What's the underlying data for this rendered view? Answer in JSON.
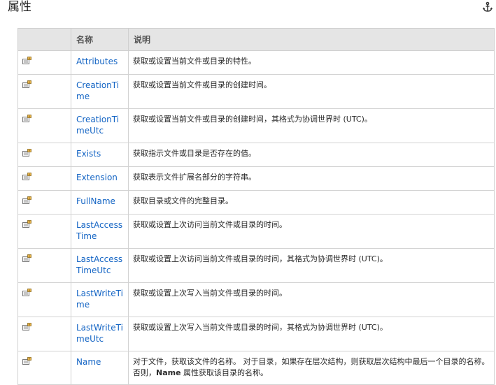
{
  "section": {
    "title": "属性",
    "anchor_icon": "anchor-icon"
  },
  "table": {
    "headers": [
      "",
      "名称",
      "说明"
    ],
    "rows": [
      {
        "icon": "property-icon",
        "name": "Attributes",
        "description": "获取或设置当前文件或目录的特性。"
      },
      {
        "icon": "property-icon",
        "name": "CreationTime",
        "description": "获取或设置当前文件或目录的创建时间。"
      },
      {
        "icon": "property-icon",
        "name": "CreationTimeUtc",
        "description": "获取或设置当前文件或目录的创建时间，其格式为协调世界时 (UTC)。"
      },
      {
        "icon": "property-icon",
        "name": "Exists",
        "description": "获取指示文件或目录是否存在的值。"
      },
      {
        "icon": "property-icon",
        "name": "Extension",
        "description": "获取表示文件扩展名部分的字符串。"
      },
      {
        "icon": "property-icon",
        "name": "FullName",
        "description": "获取目录或文件的完整目录。"
      },
      {
        "icon": "property-icon",
        "name": "LastAccessTime",
        "description": "获取或设置上次访问当前文件或目录的时间。"
      },
      {
        "icon": "property-icon",
        "name": "LastAccessTimeUtc",
        "description": "获取或设置上次访问当前文件或目录的时间，其格式为协调世界时 (UTC)。"
      },
      {
        "icon": "property-icon",
        "name": "LastWriteTime",
        "description": "获取或设置上次写入当前文件或目录的时间。"
      },
      {
        "icon": "property-icon",
        "name": "LastWriteTimeUtc",
        "description": "获取或设置上次写入当前文件或目录的时间，其格式为协调世界时 (UTC)。"
      },
      {
        "icon": "property-icon",
        "name": "Name",
        "description_before": "对于文件，获取该文件的名称。 对于目录，如果存在层次结构，则获取层次结构中最后一个目录的名称。 否则，",
        "description_bold": "Name",
        "description_after": " 属性获取该目录的名称。"
      }
    ]
  },
  "colors": {
    "link": "#1364c4",
    "header_bg": "#e5e5e5",
    "border": "#d2d2d2"
  }
}
